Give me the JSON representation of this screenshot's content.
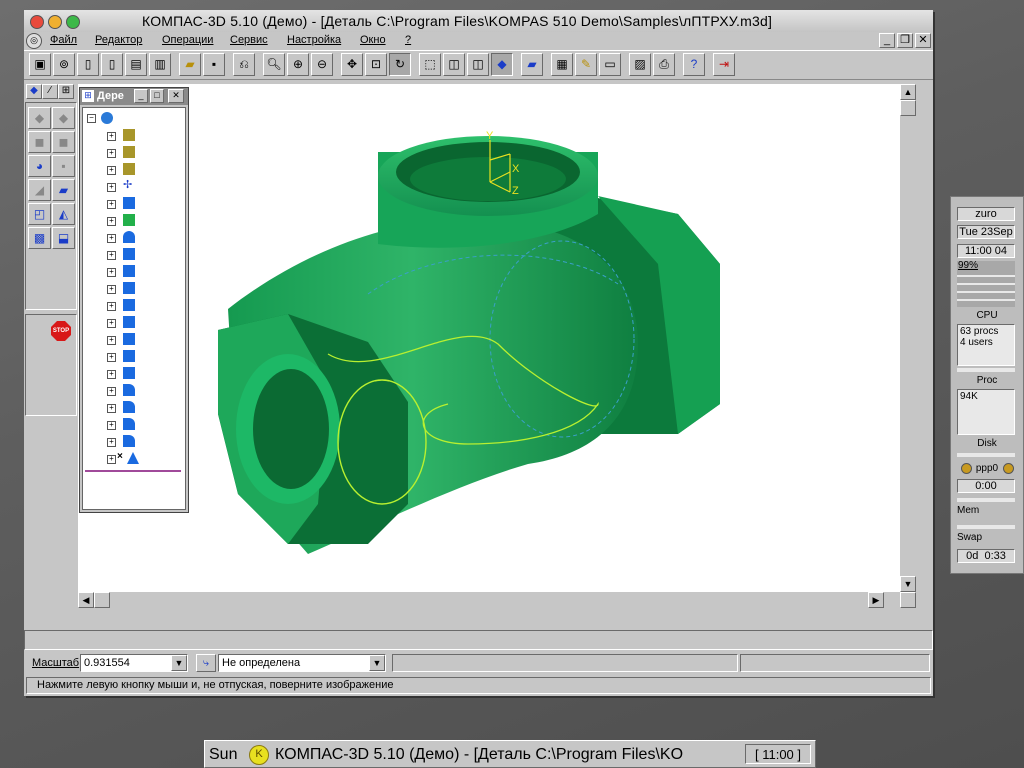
{
  "window": {
    "title": "КОМПАС-3D 5.10 (Демо) - [Деталь C:\\Program Files\\KOMPAS 510 Demo\\Samples\\лПТРХУ.m3d]"
  },
  "menu": [
    "Файл",
    "Редактор",
    "Операции",
    "Сервис",
    "Настройка",
    "Окно",
    "?"
  ],
  "mdi_controls": [
    "_",
    "❐",
    "✕"
  ],
  "tree_panel": {
    "title": "Дере",
    "controls": [
      "_",
      "□",
      "✕"
    ]
  },
  "scale": {
    "label": "Масштаб",
    "value": "0.931554",
    "orientation": "Не определена"
  },
  "hint": "Нажмите левую кнопку мыши и, не отпуская, поверните изображение",
  "monitor": {
    "user": "zuro",
    "date": "Tue 23Sep",
    "time": "11:00 04",
    "cpu_pct": "99%",
    "cpu_label": "CPU",
    "procs": "63 procs",
    "users": "4 users",
    "proc_label": "Proc",
    "mem_value": "94K",
    "disk_label": "Disk",
    "ppp": "ppp0",
    "ppp_time": "0:00",
    "mem_label": "Mem",
    "swap_label": "Swap",
    "uptime": "0d  0:33"
  },
  "taskbar": {
    "host": "Sun",
    "task": "КОМПАС-3D 5.10 (Демо) - [Деталь C:\\Program Files\\KO",
    "clock": "[ 11:00 ]"
  },
  "colors": {
    "model_green": "#1fa05a",
    "accent_yellow": "#e8e020",
    "curve_green": "#a8f030"
  }
}
